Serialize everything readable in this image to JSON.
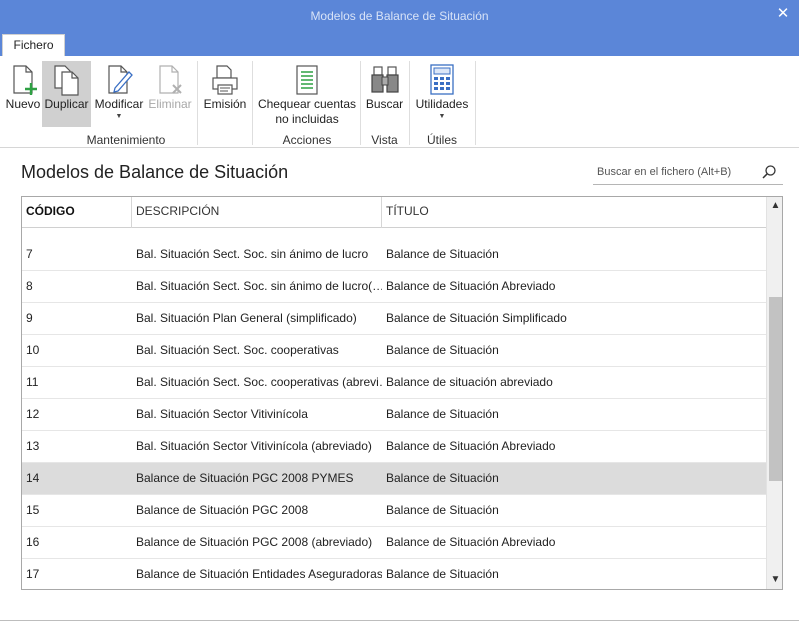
{
  "window": {
    "title": "Modelos de Balance de Situación"
  },
  "tabs": [
    {
      "label": "Fichero"
    }
  ],
  "ribbon": {
    "buttons": {
      "nuevo": {
        "label": "Nuevo"
      },
      "duplicar": {
        "label": "Duplicar"
      },
      "modificar": {
        "label": "Modificar"
      },
      "eliminar": {
        "label": "Eliminar"
      },
      "emision": {
        "label": "Emisión"
      },
      "chequear": {
        "line1": "Chequear cuentas",
        "line2": "no incluidas"
      },
      "buscar": {
        "label": "Buscar"
      },
      "utilidades": {
        "label": "Utilidades"
      }
    },
    "groups": {
      "mantenimiento": "Mantenimiento",
      "acciones": "Acciones",
      "vista": "Vista",
      "utiles": "Útiles"
    },
    "dropdown_arrow": "▼"
  },
  "page": {
    "title": "Modelos de Balance de Situación"
  },
  "search": {
    "placeholder": "Buscar en el fichero (Alt+B)"
  },
  "table": {
    "columns": [
      "CÓDIGO",
      "DESCRIPCIÓN",
      "TÍTULO"
    ],
    "rows": [
      {
        "codigo": "7",
        "descripcion": "Bal. Situación Sect. Soc. sin ánimo de lucro",
        "titulo": "Balance de Situación"
      },
      {
        "codigo": "8",
        "descripcion": "Bal. Situación Sect. Soc. sin ánimo de lucro(…",
        "titulo": "Balance de Situación Abreviado"
      },
      {
        "codigo": "9",
        "descripcion": "Bal. Situación Plan General (simplificado)",
        "titulo": "Balance de Situación Simplificado"
      },
      {
        "codigo": "10",
        "descripcion": "Bal. Situación Sect. Soc. cooperativas",
        "titulo": "Balance de Situación"
      },
      {
        "codigo": "11",
        "descripcion": "Bal. Situación Sect. Soc. cooperativas (abrevi…",
        "titulo": "Balance de situación abreviado"
      },
      {
        "codigo": "12",
        "descripcion": "Bal. Situación Sector Vitivinícola",
        "titulo": "Balance de Situación"
      },
      {
        "codigo": "13",
        "descripcion": "Bal. Situación Sector Vitivinícola (abreviado)",
        "titulo": "Balance de Situación Abreviado"
      },
      {
        "codigo": "14",
        "descripcion": "Balance de Situación PGC 2008 PYMES",
        "titulo": "Balance de Situación"
      },
      {
        "codigo": "15",
        "descripcion": "Balance de Situación PGC 2008",
        "titulo": "Balance de Situación"
      },
      {
        "codigo": "16",
        "descripcion": "Balance de Situación PGC 2008 (abreviado)",
        "titulo": "Balance de Situación Abreviado"
      },
      {
        "codigo": "17",
        "descripcion": "Balance de Situación Entidades Aseguradoras",
        "titulo": "Balance de Situación"
      }
    ],
    "selected_codigo": "14"
  },
  "scrollbar": {
    "up_arrow": "▲",
    "down_arrow": "▼"
  },
  "colors": {
    "titlebar": "#5b86d8",
    "selected_row": "#dcdcdc",
    "accent_green": "#2ea043"
  }
}
